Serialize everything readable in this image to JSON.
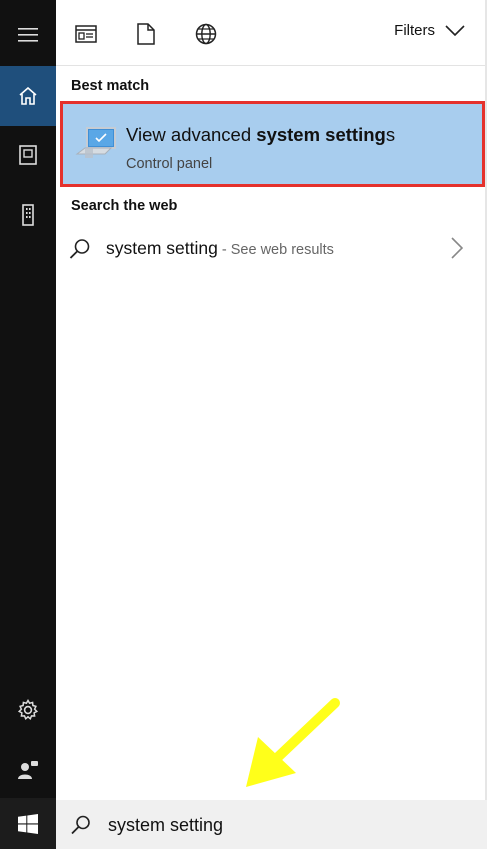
{
  "rail": {
    "items": [
      {
        "icon": "hamburger-menu-icon"
      },
      {
        "icon": "home-icon"
      },
      {
        "icon": "documents-icon"
      },
      {
        "icon": "building-icon"
      },
      {
        "icon": "gear-icon"
      },
      {
        "icon": "user-feedback-icon"
      },
      {
        "icon": "windows-logo-icon"
      }
    ]
  },
  "topbar": {
    "tabs": [
      {
        "icon": "apps-icon"
      },
      {
        "icon": "document-icon"
      },
      {
        "icon": "globe-icon"
      }
    ],
    "filters_label": "Filters"
  },
  "results": {
    "best_match_heading": "Best match",
    "best_match": {
      "title_prefix": "View advanced ",
      "title_bold": "system setting",
      "title_suffix": "s",
      "subtitle": "Control panel",
      "icon": "computer-settings-icon"
    },
    "web_heading": "Search the web",
    "web_result": {
      "query": "system setting",
      "hint": " - See web results"
    }
  },
  "search": {
    "value": "system setting",
    "placeholder": ""
  },
  "colors": {
    "rail_bg": "#111111",
    "rail_active": "#1f4f7c",
    "highlight_bg": "#a8cdee",
    "highlight_border": "#e5312c",
    "annotation_arrow": "#ffff1a"
  }
}
